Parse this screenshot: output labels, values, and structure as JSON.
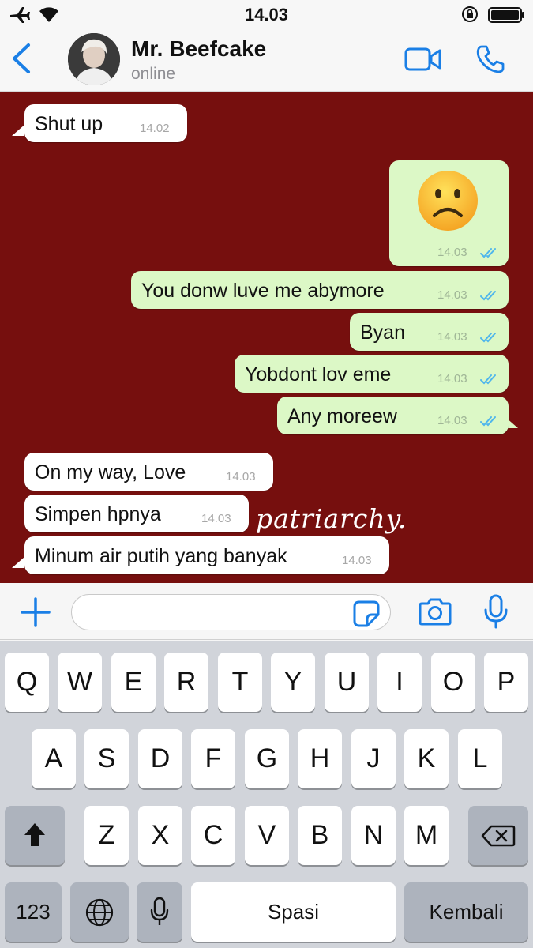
{
  "status_bar": {
    "time": "14.03"
  },
  "header": {
    "name": "Mr. Beefcake",
    "status": "online"
  },
  "messages": [
    {
      "dir": "in",
      "text": "Shut up",
      "time": "14.02"
    },
    {
      "dir": "out",
      "text": "",
      "emoji": "frowning-face",
      "time": "14.03"
    },
    {
      "dir": "out",
      "text": "You donw luve me abymore",
      "time": "14.03"
    },
    {
      "dir": "out",
      "text": "Byan",
      "time": "14.03"
    },
    {
      "dir": "out",
      "text": "Yobdont lov eme",
      "time": "14.03"
    },
    {
      "dir": "out",
      "text": "Any moreew",
      "time": "14.03"
    },
    {
      "dir": "in",
      "text": "On my way, Love",
      "time": "14.03"
    },
    {
      "dir": "in",
      "text": "Simpen hpnya",
      "time": "14.03"
    },
    {
      "dir": "in",
      "text": "Minum air putih yang banyak",
      "time": "14.03"
    }
  ],
  "watermark": "patriarchy.",
  "input": {
    "value": ""
  },
  "keyboard": {
    "row1": [
      "Q",
      "W",
      "E",
      "R",
      "T",
      "Y",
      "U",
      "I",
      "O",
      "P"
    ],
    "row2": [
      "A",
      "S",
      "D",
      "F",
      "G",
      "H",
      "J",
      "K",
      "L"
    ],
    "row3": [
      "Z",
      "X",
      "C",
      "V",
      "B",
      "N",
      "M"
    ],
    "numbers": "123",
    "space": "Spasi",
    "return": "Kembali"
  },
  "colors": {
    "chat_background": "#760f0e",
    "incoming_bubble": "#ffffff",
    "outgoing_bubble": "#dcf8c6",
    "accent": "#1a7fe6",
    "read_ticks": "#4fb6ec"
  }
}
